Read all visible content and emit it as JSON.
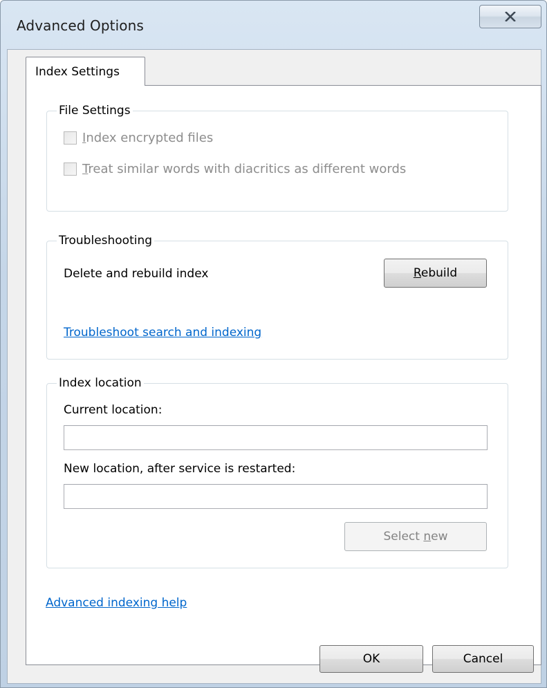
{
  "window": {
    "title": "Advanced Options"
  },
  "tabs": [
    {
      "label": "Index Settings",
      "selected": true
    }
  ],
  "file_settings": {
    "title": "File Settings",
    "checkboxes": [
      {
        "accel": "I",
        "rest": "ndex encrypted files",
        "checked": false,
        "enabled": false
      },
      {
        "accel": "T",
        "rest": "reat similar words with diacritics as different words",
        "checked": false,
        "enabled": false
      }
    ]
  },
  "troubleshooting": {
    "title": "Troubleshooting",
    "rebuild_label": "Delete and rebuild index",
    "rebuild_button": {
      "accel": "R",
      "rest": "ebuild"
    },
    "troubleshoot_link": "Troubleshoot search and indexing"
  },
  "index_location": {
    "title": "Index location",
    "current_label": "Current location:",
    "current_value": "",
    "new_label": "New location, after service is restarted:",
    "new_value": "",
    "select_button": {
      "pre": "Select ",
      "accel": "n",
      "rest": "ew",
      "enabled": false
    }
  },
  "help_link": "Advanced indexing help",
  "footer": {
    "ok_label": "OK",
    "cancel_label": "Cancel"
  }
}
